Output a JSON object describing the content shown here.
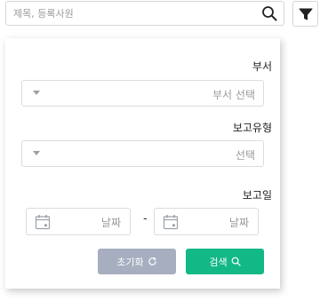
{
  "search": {
    "placeholder": "제목, 등록사원"
  },
  "icons": {
    "search": "search-icon",
    "filter": "filter-icon",
    "calendar": "calendar-icon",
    "refresh": "refresh-icon",
    "dropdown": "chevron-down-icon"
  },
  "filter": {
    "department": {
      "label": "부서",
      "placeholder": "부서 선택"
    },
    "report_type": {
      "label": "보고유형",
      "placeholder": "선택"
    },
    "report_date": {
      "label": "보고일",
      "start_placeholder": "날짜",
      "separator": "-",
      "end_placeholder": "날짜"
    },
    "reset_label": "초기화",
    "search_label": "검색"
  },
  "colors": {
    "reset_button": "#a6aebf",
    "search_button": "#12b886"
  }
}
